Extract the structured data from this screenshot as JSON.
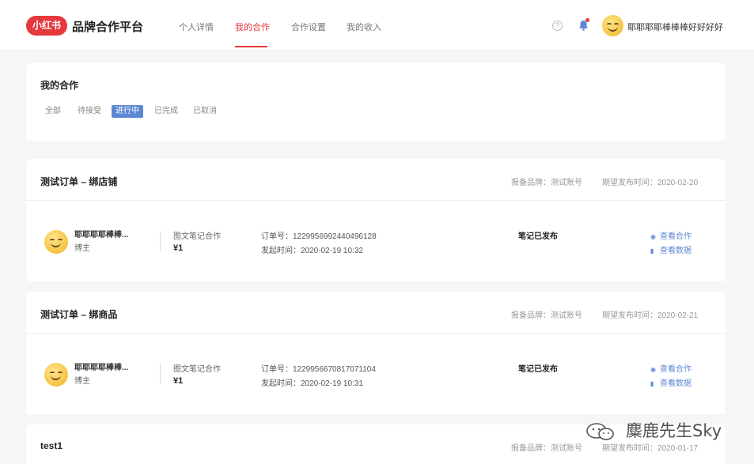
{
  "header": {
    "logo": "小红书",
    "platform_title": "品牌合作平台",
    "nav": [
      "个人详情",
      "我的合作",
      "合作设置",
      "我的收入"
    ],
    "help_icon": "help-circle-icon",
    "bell_icon": "bell-icon",
    "user_name": "耶耶耶耶棒棒棒好好好好",
    "accent_color": "#e6393d"
  },
  "filter": {
    "title": "我的合作",
    "tabs": [
      "全部",
      "待接受",
      "进行中",
      "已完成",
      "已取消"
    ],
    "active_tab": "进行中",
    "active_color": "#5b87d4"
  },
  "labels": {
    "brand_prefix": "报备品牌：",
    "publish_prefix": "期望发布时间：",
    "order_prefix": "订单号：",
    "created_prefix": "发起时间：",
    "view_coop": "查看合作",
    "view_data": "查看数据"
  },
  "orders": [
    {
      "title": "测试订单 – 绑店铺",
      "brand": "报备品牌：测试账号",
      "publish_time": "期望发布时间：2020-02-20",
      "blogger_name": "耶耶耶耶棒棒...",
      "blogger_role": "博主",
      "coop_type": "图文笔记合作",
      "price": "¥1",
      "order_no": "订单号：1229956992440496128",
      "created": "发起时间：2020-02-19 10:32",
      "status": "笔记已发布",
      "view_coop": "查看合作",
      "view_data": "查看数据"
    },
    {
      "title": "测试订单 – 绑商品",
      "brand": "报备品牌：测试账号",
      "publish_time": "期望发布时间：2020-02-21",
      "blogger_name": "耶耶耶耶棒棒...",
      "blogger_role": "博主",
      "coop_type": "图文笔记合作",
      "price": "¥1",
      "order_no": "订单号：1229956670817071104",
      "created": "发起时间：2020-02-19 10:31",
      "status": "笔记已发布",
      "view_coop": "查看合作",
      "view_data": "查看数据"
    },
    {
      "title": "test1",
      "brand": "报备品牌：测试账号",
      "publish_time": "期望发布时间：2020-01-17"
    }
  ],
  "watermark": "麋鹿先生Sky"
}
